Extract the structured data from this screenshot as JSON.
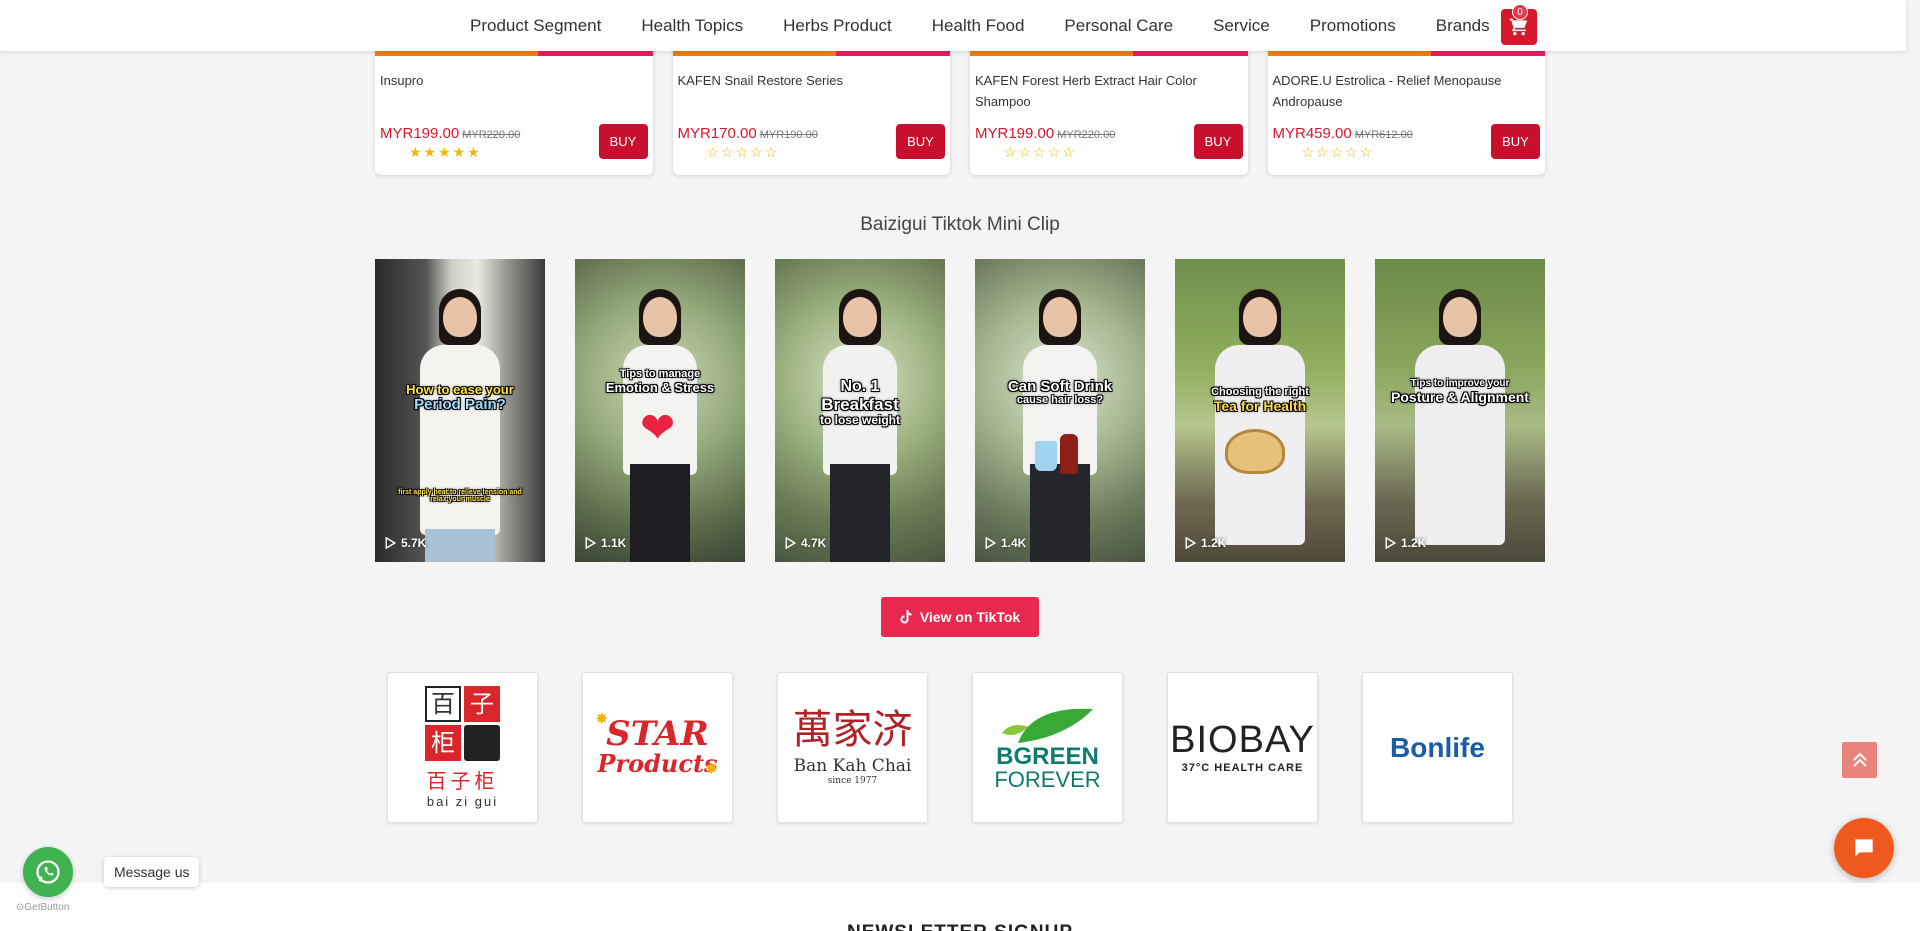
{
  "nav": {
    "items": [
      "Product Segment",
      "Health Topics",
      "Herbs Product",
      "Health Food",
      "Personal Care",
      "Service",
      "Promotions",
      "Brands"
    ],
    "cart_count": "0"
  },
  "products": [
    {
      "name": "Insupro",
      "price": "MYR199.00",
      "old_price": "MYR220.00",
      "stars": "★★★★★",
      "buy": "BUY"
    },
    {
      "name": "KAFEN Snail Restore Series",
      "price": "MYR170.00",
      "old_price": "MYR190.00",
      "stars": "☆☆☆☆☆",
      "buy": "BUY"
    },
    {
      "name": "KAFEN Forest Herb Extract Hair Color Shampoo",
      "price": "MYR199.00",
      "old_price": "MYR220.00",
      "stars": "☆☆☆☆☆",
      "buy": "BUY"
    },
    {
      "name": "ADORE.U Estrolica - Relief Menopause Andropause",
      "price": "MYR459.00",
      "old_price": "MYR612.00",
      "stars": "☆☆☆☆☆",
      "buy": "BUY"
    }
  ],
  "tiktok": {
    "title": "Baizigui Tiktok Mini Clip",
    "clips": [
      {
        "line1": "How to ease your",
        "line2": "Period Pain?",
        "extra": "first apply heat to relieve tension and relax your muscle",
        "views": "5.7K"
      },
      {
        "line1": "Tips to manage",
        "line2": "Emotion & Stress",
        "extra": "",
        "views": "1.1K"
      },
      {
        "line1": "No. 1",
        "line2": "Breakfast",
        "extra": "to lose weight",
        "views": "4.7K"
      },
      {
        "line1": "Can Soft Drink",
        "line2": "cause hair loss?",
        "extra": "",
        "views": "1.4K"
      },
      {
        "line1": "Choosing the right",
        "line2": "Tea for Health",
        "extra": "",
        "views": "1.2K"
      },
      {
        "line1": "Tips to improve your",
        "line2": "Posture & Alignment",
        "extra": "",
        "views": "1.2K"
      }
    ],
    "button_label": "View on TikTok"
  },
  "brands": [
    {
      "name": "百子柜",
      "sub": "bai zi gui"
    },
    {
      "name": "STAR",
      "sub": "Products"
    },
    {
      "name": "萬家济",
      "sub": "Ban Kah Chai",
      "since": "since 1977"
    },
    {
      "name": "BGREEN",
      "sub": "FOREVER"
    },
    {
      "name": "BIOBAY",
      "sub": "37°C HEALTH CARE"
    },
    {
      "name": "Bonlife",
      "sub": ""
    }
  ],
  "whatsapp": {
    "label": "Message us",
    "credit": "GetButton"
  },
  "newsletter": {
    "title": "NEWSLETTER SIGNUP"
  },
  "colors": {
    "accent": "#d6182b",
    "tiktok": "#e8294f",
    "chat": "#f05a1f",
    "whatsapp": "#3fb34f"
  }
}
